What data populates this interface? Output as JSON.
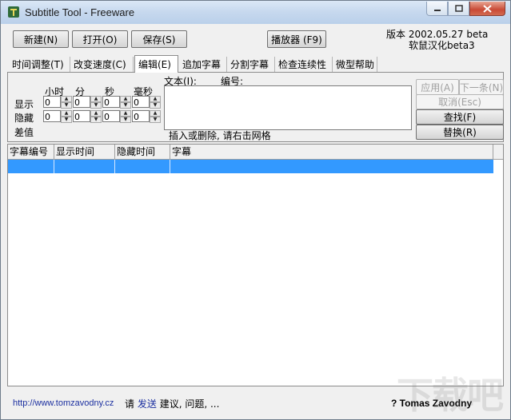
{
  "window": {
    "title": "Subtitle Tool - Freeware"
  },
  "toolbar": {
    "new_label": "新建(N)",
    "open_label": "打开(O)",
    "save_label": "保存(S)",
    "player_label": "播放器 (F9)"
  },
  "version": {
    "line1": "版本 2002.05.27 beta",
    "line2": "软鼠汉化beta3"
  },
  "tabs": [
    {
      "label": "时间调整(T)"
    },
    {
      "label": "改变速度(C)"
    },
    {
      "label": "编辑(E)"
    },
    {
      "label": "追加字幕"
    },
    {
      "label": "分割字幕"
    },
    {
      "label": "检查连续性"
    },
    {
      "label": "微型帮助"
    }
  ],
  "editor": {
    "col_hours": "小时",
    "col_minutes": "分",
    "col_seconds": "秒",
    "col_ms": "毫秒",
    "row_show": "显示",
    "row_hide": "隐藏",
    "diff_label": "差值",
    "text_label": "文本(I):",
    "number_label": "编号:",
    "show_values": [
      "0",
      "0",
      "0",
      "0"
    ],
    "hide_values": [
      "0",
      "0",
      "0",
      "0"
    ],
    "hint": "插入或删除, 请右击网格",
    "apply_label": "应用(A)",
    "next_label": "下一条(N)",
    "cancel_label": "取消(Esc)",
    "find_label": "查找(F)",
    "replace_label": "替换(R)"
  },
  "grid": {
    "columns": [
      "字幕编号",
      "显示时间",
      "隐藏时间",
      "字幕"
    ]
  },
  "status": {
    "url": "http://www.tomzavodny.cz",
    "msg_prefix": "请",
    "msg_send": "发送",
    "msg_rest": "建议, 问题, ...",
    "author": "? Tomas Zavodny"
  },
  "watermark": "下载吧",
  "colors": {
    "selection": "#3399ff",
    "link": "#1b2fa0"
  }
}
